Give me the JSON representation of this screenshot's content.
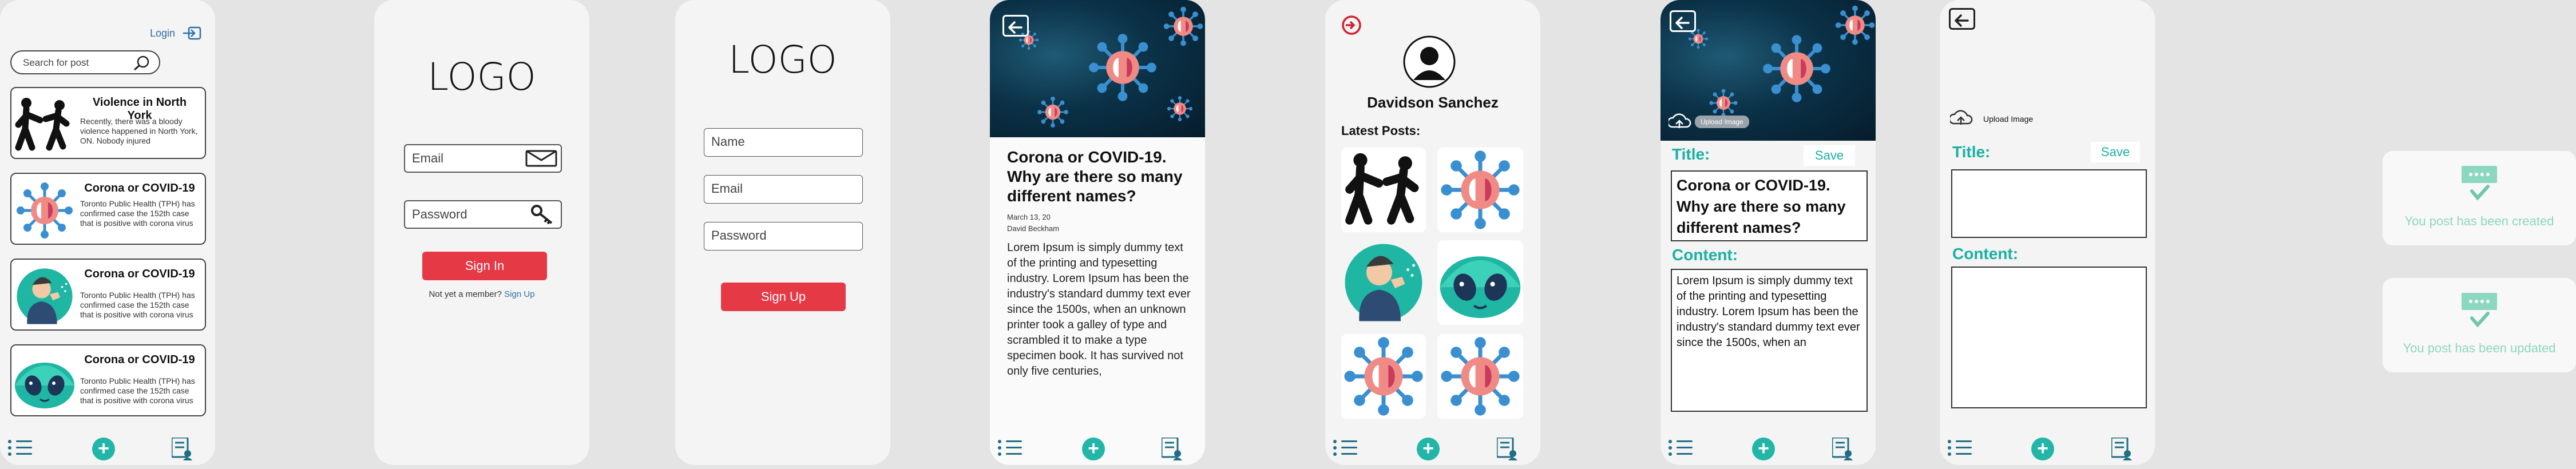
{
  "feed": {
    "login_label": "Login",
    "search_placeholder": "Search for post",
    "posts": [
      {
        "title": "Violence in North York",
        "desc": "Recently, there was a bloody violence happened in North York, ON. Nobody injured",
        "icon": "violence-illustration"
      },
      {
        "title": "Corona or COVID-19",
        "desc": "Toronto Public Health (TPH) has confirmed case the 152th case that is positive with corona virus",
        "icon": "virus-illustration"
      },
      {
        "title": "Corona or COVID-19",
        "desc": "Toronto Public Health (TPH) has confirmed case the 152th case that is positive with corona virus",
        "icon": "man-coughing-illustration"
      },
      {
        "title": "Corona or COVID-19",
        "desc": "Toronto Public Health (TPH) has confirmed case the 152th case that is positive with corona virus",
        "icon": "alien-face-illustration"
      }
    ]
  },
  "signin": {
    "logo": "LOGO",
    "email_placeholder": "Email",
    "password_placeholder": "Password",
    "signin_label": "Sign In",
    "footer_text": "Not yet a member?",
    "signup_link": "Sign Up"
  },
  "signup": {
    "logo": "LOGO",
    "name_placeholder": "Name",
    "email_placeholder": "Email",
    "password_placeholder": "Password",
    "signup_label": "Sign Up"
  },
  "article": {
    "title": "Corona or COVID-19. Why are there so many different names?",
    "date": "March 13, 20",
    "author": "David Beckham",
    "body": "Lorem Ipsum is simply dummy text of the printing and typesetting industry. Lorem Ipsum has been the industry's standard dummy text ever since the 1500s, when an unknown printer took a galley of type and scrambled it to make a type specimen book. It has survived not only five centuries,"
  },
  "profile": {
    "name": "Davidson Sanchez",
    "latest_label": "Latest Posts:"
  },
  "edit": {
    "upload_label": "Upload Image",
    "title_label": "Title:",
    "save_label": "Save",
    "title_value": "Corona or COVID-19. Why are there so many different names?",
    "content_label": "Content:",
    "content_value": "Lorem Ipsum is simply dummy text of the printing and typesetting industry. Lorem Ipsum has been the industry's standard dummy text ever since the 1500s, when an"
  },
  "create": {
    "upload_label": "Upload Image",
    "title_label": "Title:",
    "save_label": "Save",
    "content_label": "Content:"
  },
  "toasts": {
    "created": "You post has been created",
    "updated": "You post has been updated"
  },
  "colors": {
    "accent_teal": "#21b6a8",
    "nav_blue": "#1f6e84",
    "button_red": "#e53946",
    "success_green": "#8cd7bf"
  }
}
